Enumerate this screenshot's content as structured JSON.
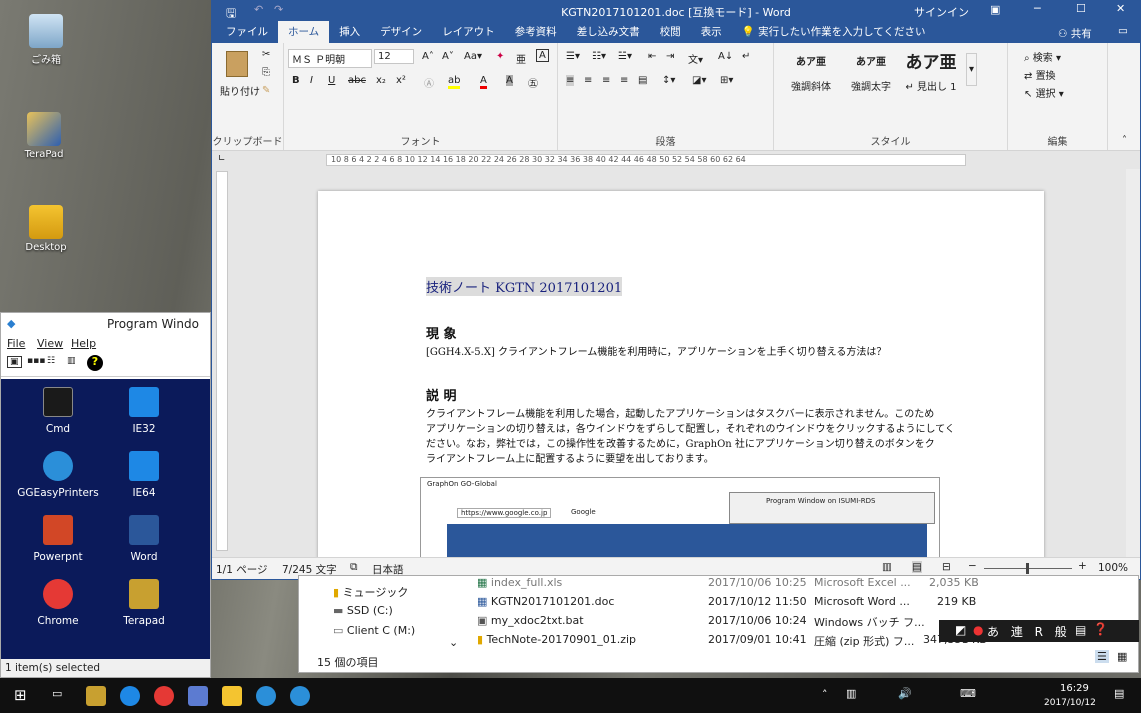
{
  "desktop": {
    "icons": [
      {
        "label": "ごみ箱",
        "icon": "recycle-bin-icon"
      },
      {
        "label": "TeraPad",
        "icon": "terapad-icon"
      },
      {
        "label": "Desktop",
        "icon": "desktop-folder-icon"
      }
    ]
  },
  "word": {
    "title": "KGTN2017101201.doc [互換モード] - Word",
    "signin": "サインイン",
    "tabs": [
      "ファイル",
      "ホーム",
      "挿入",
      "デザイン",
      "レイアウト",
      "参考資料",
      "差し込み文書",
      "校閲",
      "表示"
    ],
    "tell_me": "実行したい作業を入力してください",
    "share": "共有",
    "ribbon": {
      "paste": "貼り付け",
      "clipboard_label": "クリップボード",
      "font_name": "ＭＳ Ｐ明朝",
      "font_size": "12",
      "font_label": "フォント",
      "paragraph_label": "段落",
      "styles_label": "スタイル",
      "editing_label": "編集",
      "styles": [
        {
          "sample": "あア亜",
          "name": "強調斜体"
        },
        {
          "sample": "あア亜",
          "name": "強調太字"
        },
        {
          "sample": "あア亜",
          "name": "↵ 見出し 1"
        }
      ],
      "editing": [
        "検索 ▾",
        "置換",
        "選択 ▾"
      ]
    },
    "ruler": "10  8  6  4  2      2  4  6  8  10  12  14  16  18  20  22  24  26  28  30  32  34  36  38  40  42  44  46  48  50  52  54      58  60  62  64",
    "document": {
      "heading": "技術ノート KGTN 2017101201",
      "section1_title": "現 象",
      "section1_text": "[GGH4.X-5.X] クライアントフレーム機能を利用時に，アプリケーションを上手く切り替える方法は？",
      "section2_title": "説 明",
      "section2_text": "クライアントフレーム機能を利用した場合，起動したアプリケーションはタスクバーに表示されません。このため",
      "section2_text2": "アプリケーションの切り替えは，各ウインドウをずらして配置し，それぞれのウインドウをクリックするようにしてく",
      "section2_text3": "ださい。なお，弊社では，この操作性を改善するために，GraphOn 社にアプリケーション切り替えのボタンをク",
      "section2_text4": "ライアントフレーム上に配置するように要望を出しております。",
      "embedded_title": "GraphOn GO-Global",
      "embedded_url": "https://www.google.co.jp",
      "embedded_tab": "Google",
      "embedded_prog": "Program Window on ISUMI-RDS"
    },
    "status": {
      "page": "1/1 ページ",
      "words": "7/245 文字",
      "lang": "日本語",
      "zoom": "100%"
    }
  },
  "explorer": {
    "nav": [
      {
        "label": "ミュージック",
        "icon": "music-folder-icon"
      },
      {
        "label": "SSD (C:)",
        "icon": "drive-icon"
      },
      {
        "label": "Client C (M:)",
        "icon": "network-drive-icon"
      }
    ],
    "files": [
      {
        "name": "index_full.xls",
        "date": "2017/10/06 10:25",
        "type": "Microsoft Excel ...",
        "size": "2,035 KB"
      },
      {
        "name": "KGTN2017101201.doc",
        "date": "2017/10/12 11:50",
        "type": "Microsoft Word ...",
        "size": "219 KB"
      },
      {
        "name": "my_xdoc2txt.bat",
        "date": "2017/10/06 10:24",
        "type": "Windows バッチ フ...",
        "size": ""
      },
      {
        "name": "TechNote-20170901_01.zip",
        "date": "2017/09/01 10:41",
        "type": "圧縮 (zip 形式) フ...",
        "size": "347,351 KB"
      }
    ],
    "count": "15 個の項目"
  },
  "progwin": {
    "title": "Program Windo",
    "menu": [
      "File",
      "View",
      "Help"
    ],
    "items": [
      {
        "label": "Cmd",
        "color": "#1a1a1a"
      },
      {
        "label": "IE32",
        "color": "#1e88e5"
      },
      {
        "label": "GGEasyPrinters",
        "color": "#2b8fd9"
      },
      {
        "label": "IE64",
        "color": "#1e88e5"
      },
      {
        "label": "Powerpnt",
        "color": "#d24726"
      },
      {
        "label": "Word",
        "color": "#2b579a"
      },
      {
        "label": "Chrome",
        "color": "#e53935"
      },
      {
        "label": "Terapad",
        "color": "#c8a030"
      }
    ],
    "status": "1 item(s) selected"
  },
  "ime": {
    "text": "あ 連 R 般"
  },
  "taskbar": {
    "time": "16:29",
    "date": "2017/10/12"
  }
}
